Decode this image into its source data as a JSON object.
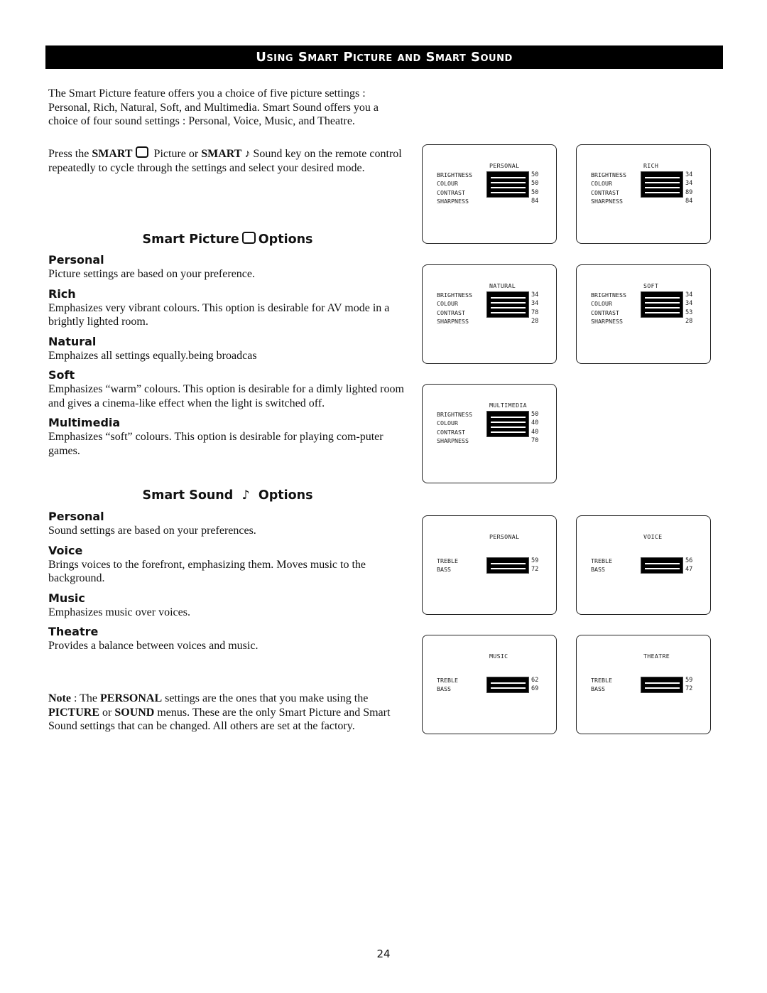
{
  "header": {
    "title": "Using Smart Picture and Smart Sound"
  },
  "intro": {
    "paragraph1": "The Smart Picture feature offers you a choice of five picture settings : Personal, Rich, Natural, Soft, and Multimedia. Smart Sound offers you a choice of four sound settings : Personal, Voice, Music, and Theatre.",
    "p2_a": "Press the ",
    "p2_smart1": "SMART",
    "p2_b": " Picture or ",
    "p2_smart2": "SMART",
    "p2_note_icon": "♪",
    "p2_c": " Sound key on the remote control repeatedly to cycle through the settings and select your desired mode."
  },
  "picture_section": {
    "title_a": "Smart Picture",
    "title_b": "Options",
    "options": [
      {
        "name": "Personal",
        "desc": "Picture settings are based on your preference."
      },
      {
        "name": "Rich",
        "desc": "Emphasizes very vibrant colours. This option is desirable for AV mode in a brightly lighted room."
      },
      {
        "name": "Natural",
        "desc": "Emphaizes all settings equally.being broadcas"
      },
      {
        "name": "Soft",
        "desc": "Emphasizes “warm” colours. This option is desirable for a dimly lighted room and gives a cinema-like effect when the light is switched off."
      },
      {
        "name": "Multimedia",
        "desc": "Emphasizes “soft” colours. This option is desirable for playing com-puter games."
      }
    ]
  },
  "sound_section": {
    "title_a": "Smart Sound",
    "note_icon": "♪",
    "title_b": "Options",
    "options": [
      {
        "name": "Personal",
        "desc": "Sound settings are based on your preferences."
      },
      {
        "name": "Voice",
        "desc": "Brings voices to the forefront, emphasizing them. Moves music to the background."
      },
      {
        "name": "Music",
        "desc": "Emphasizes music over voices."
      },
      {
        "name": "Theatre",
        "desc": "Provides a balance between voices and music."
      }
    ]
  },
  "note": {
    "label": "Note",
    "a": " : The ",
    "personal": "PERSONAL",
    "b": " settings are the ones that you make using the ",
    "picture": "PICTURE",
    "c": " or ",
    "sound": "SOUND",
    "d": " menus. These are the only Smart Picture and Smart Sound settings that can be changed. All others are set at the factory."
  },
  "picture_labels": [
    "BRIGHTNESS",
    "COLOUR",
    "CONTRAST",
    "SHARPNESS"
  ],
  "sound_labels": [
    "TREBLE",
    "BASS"
  ],
  "picture_screens": [
    {
      "mode": "PERSONAL",
      "values": [
        "50",
        "50",
        "50",
        "84"
      ]
    },
    {
      "mode": "RICH",
      "values": [
        "34",
        "34",
        "89",
        "84"
      ]
    },
    {
      "mode": "NATURAL",
      "values": [
        "34",
        "34",
        "78",
        "28"
      ]
    },
    {
      "mode": "SOFT",
      "values": [
        "34",
        "34",
        "53",
        "28"
      ]
    },
    {
      "mode": "MULTIMEDIA",
      "values": [
        "50",
        "40",
        "40",
        "70"
      ]
    }
  ],
  "sound_screens": [
    {
      "mode": "PERSONAL",
      "values": [
        "59",
        "72"
      ]
    },
    {
      "mode": "VOICE",
      "values": [
        "56",
        "47"
      ]
    },
    {
      "mode": "MUSIC",
      "values": [
        "62",
        "69"
      ]
    },
    {
      "mode": "THEATRE",
      "values": [
        "59",
        "72"
      ]
    }
  ],
  "page_number": "24"
}
